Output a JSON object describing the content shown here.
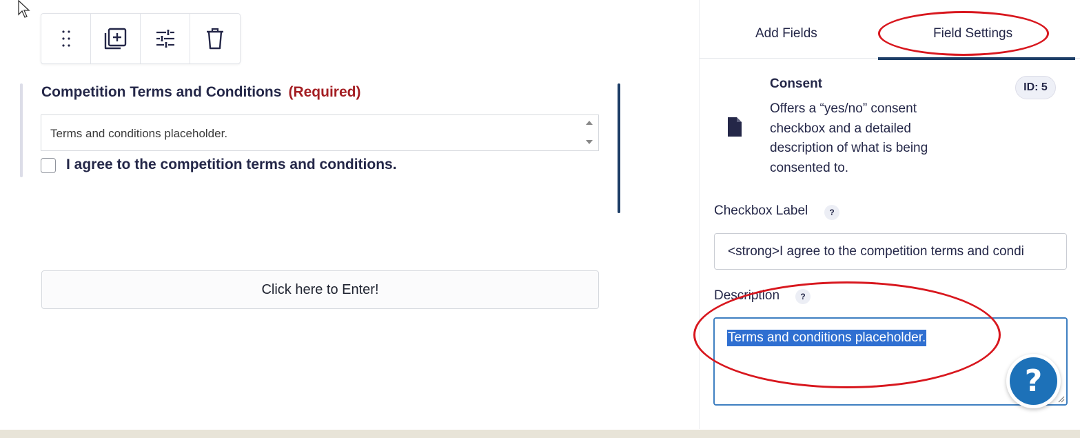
{
  "toolbar": {
    "drag_icon": "drag-handle-icon",
    "duplicate_icon": "duplicate-icon",
    "settings_icon": "sliders-icon",
    "delete_icon": "trash-icon"
  },
  "field": {
    "title": "Competition Terms and Conditions",
    "required_label": "(Required)",
    "description": "Terms and conditions placeholder.",
    "checkbox_label": "I agree to the competition terms and conditions."
  },
  "submit": {
    "label": "Click here to Enter!"
  },
  "panel": {
    "tabs": [
      {
        "label": "Add Fields"
      },
      {
        "label": "Field Settings",
        "active": true
      }
    ],
    "field_type": {
      "title": "Consent",
      "description": "Offers a “yes/no” consent checkbox and a detailed description of what is being consented to.",
      "id_badge": "ID: 5"
    },
    "checkbox_label": {
      "label": "Checkbox Label",
      "help": "?",
      "value": "<strong>I agree to the competition terms and condi"
    },
    "description": {
      "label": "Description",
      "help": "?",
      "value": "Terms and conditions placeholder."
    },
    "help_button": "?"
  },
  "colors": {
    "accent": "#1c3d66",
    "required": "#a41e23",
    "annotation": "#d8171e",
    "selection": "#2f6fd1",
    "help": "#1d71b8"
  }
}
